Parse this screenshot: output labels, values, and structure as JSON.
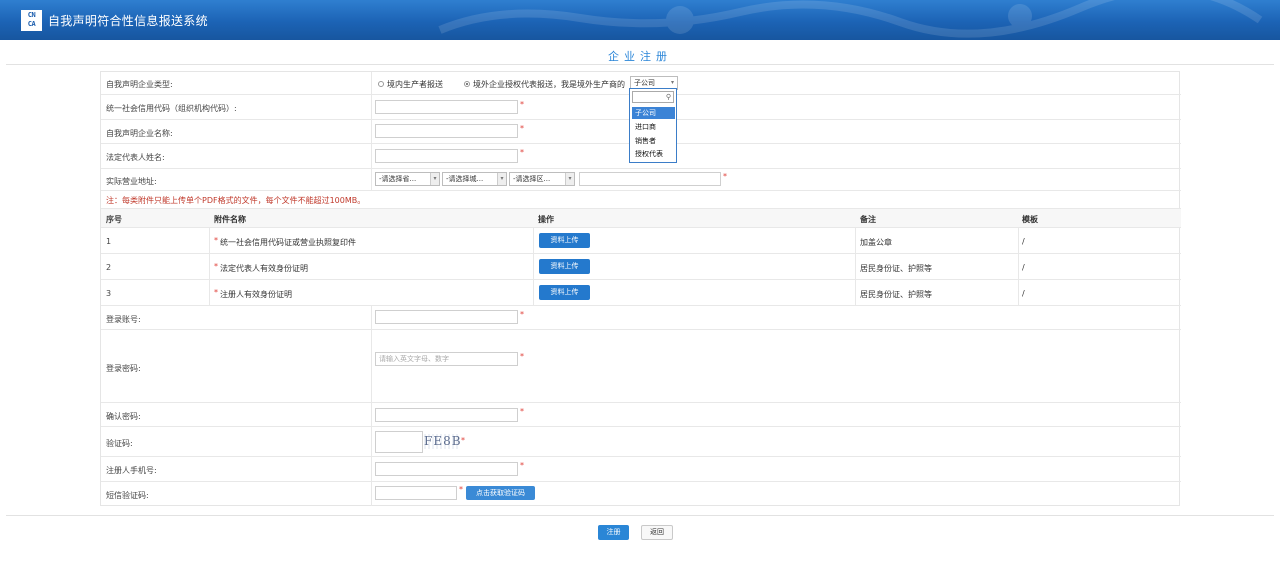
{
  "header": {
    "logo_text": "CN\nCA",
    "system_title": "自我声明符合性信息报送系统"
  },
  "page": {
    "title": "企业注册"
  },
  "form": {
    "enterprise_type": {
      "label": "自我声明企业类型:",
      "option_domestic": "境内生产者报送",
      "option_overseas": "境外企业授权代表报送，我是境外生产商的",
      "selected": "子公司",
      "dropdown_options": [
        "子公司",
        "进口商",
        "销售者",
        "授权代表"
      ]
    },
    "credit_code": {
      "label": "统一社会信用代码（组织机构代码）:"
    },
    "company_name": {
      "label": "自我声明企业名称:"
    },
    "legal_rep": {
      "label": "法定代表人姓名:"
    },
    "address": {
      "label": "实际营业地址:",
      "province": "-请选择省...",
      "city": "-请选择城...",
      "district": "-请选择区..."
    },
    "notice": "注：每类附件只能上传单个PDF格式的文件，每个文件不能超过100MB。",
    "attachments": {
      "headers": [
        "序号",
        "附件名称",
        "操作",
        "备注",
        "模板"
      ],
      "upload_label": "资料上传",
      "rows": [
        {
          "no": "1",
          "name": "统一社会信用代码证或营业执照复印件",
          "note": "加盖公章",
          "template": "/"
        },
        {
          "no": "2",
          "name": "法定代表人有效身份证明",
          "note": "居民身份证、护照等",
          "template": "/"
        },
        {
          "no": "3",
          "name": "注册人有效身份证明",
          "note": "居民身份证、护照等",
          "template": "/"
        }
      ]
    },
    "account": {
      "label": "登录账号:"
    },
    "password": {
      "label": "登录密码:",
      "placeholder": "请输入英文字母、数字"
    },
    "confirm_password": {
      "label": "确认密码:"
    },
    "captcha": {
      "label": "验证码:",
      "image_text": "FE8B"
    },
    "phone": {
      "label": "注册人手机号:"
    },
    "sms_code": {
      "label": "短信验证码:",
      "button": "点击获取验证码"
    }
  },
  "actions": {
    "register": "注册",
    "back": "返回"
  },
  "required_mark": "*"
}
